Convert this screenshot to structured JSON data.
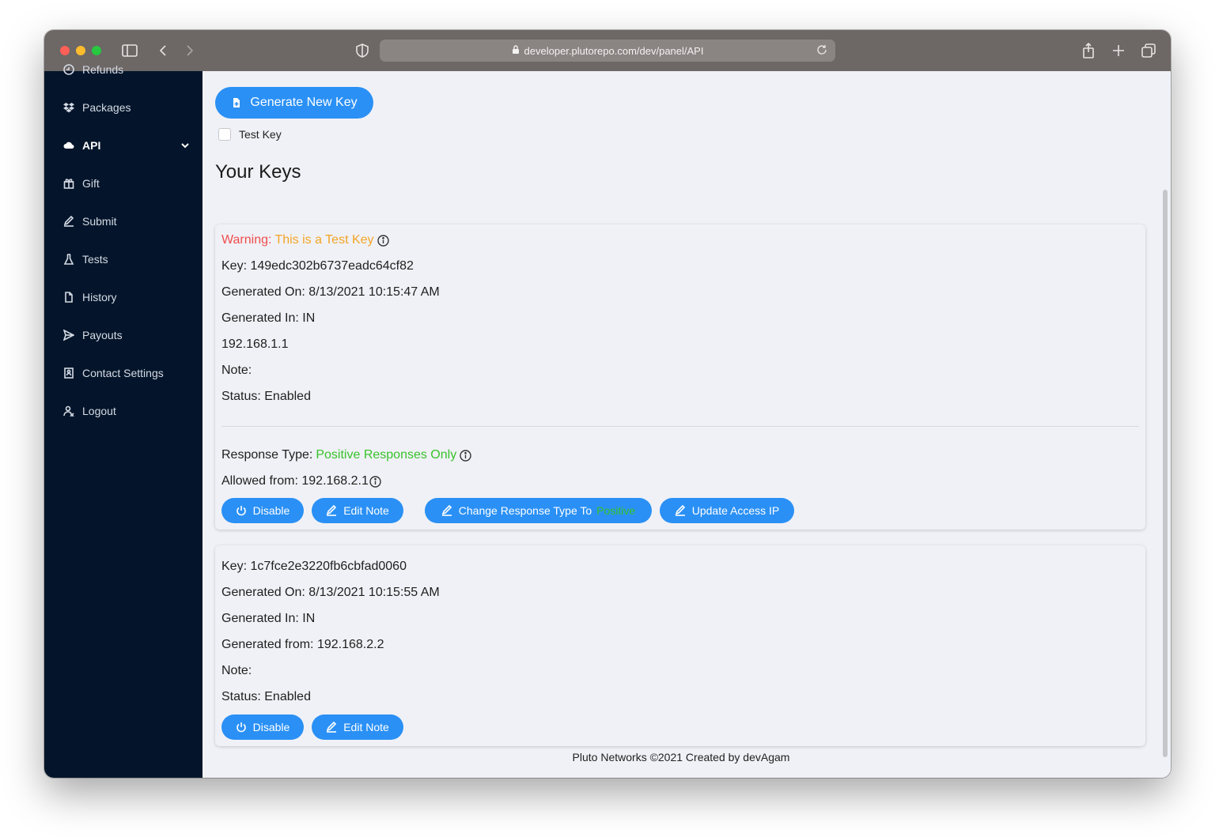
{
  "browser": {
    "url": "developer.plutorepo.com/dev/panel/API"
  },
  "sidebar": {
    "items": [
      {
        "label": "Refunds"
      },
      {
        "label": "Packages"
      },
      {
        "label": "API"
      },
      {
        "label": "Gift"
      },
      {
        "label": "Submit"
      },
      {
        "label": "Tests"
      },
      {
        "label": "History"
      },
      {
        "label": "Payouts"
      },
      {
        "label": "Contact Settings"
      },
      {
        "label": "Logout"
      }
    ]
  },
  "main": {
    "generate_label": "Generate New Key",
    "test_key_label": "Test Key",
    "heading": "Your Keys",
    "keys": [
      {
        "warning_label": "Warning:",
        "warning_text": "This is a Test Key",
        "key": "Key: 149edc302b6737eadc64cf82",
        "generated_on": "Generated On: 8/13/2021 10:15:47 AM",
        "generated_in": "Generated In: IN",
        "ip": "192.168.1.1",
        "note": "Note:",
        "status": "Status: Enabled",
        "response_type_label": "Response Type:",
        "response_type_value": "Positive Responses Only",
        "allowed_from": "Allowed from: 192.168.2.1",
        "disable_label": "Disable",
        "edit_note_label": "Edit Note",
        "change_response_label": "Change Response Type To",
        "change_response_value": "Positive",
        "update_ip_label": "Update Access IP"
      },
      {
        "key": "Key: 1c7fce2e3220fb6cbfad0060",
        "generated_on": "Generated On: 8/13/2021 10:15:55 AM",
        "generated_in": "Generated In: IN",
        "generated_from": "Generated from: 192.168.2.2",
        "note": "Note:",
        "status": "Status: Enabled",
        "disable_label": "Disable",
        "edit_note_label": "Edit Note"
      }
    ]
  },
  "footer": {
    "text": "Pluto Networks ©2021 Created by devAgam"
  },
  "colors": {
    "sidebar_bg": "#04152b",
    "accent": "#2a90f5",
    "warning_red": "#ef4d4d",
    "warning_orange": "#f2a427",
    "positive_green": "#38c22b"
  }
}
